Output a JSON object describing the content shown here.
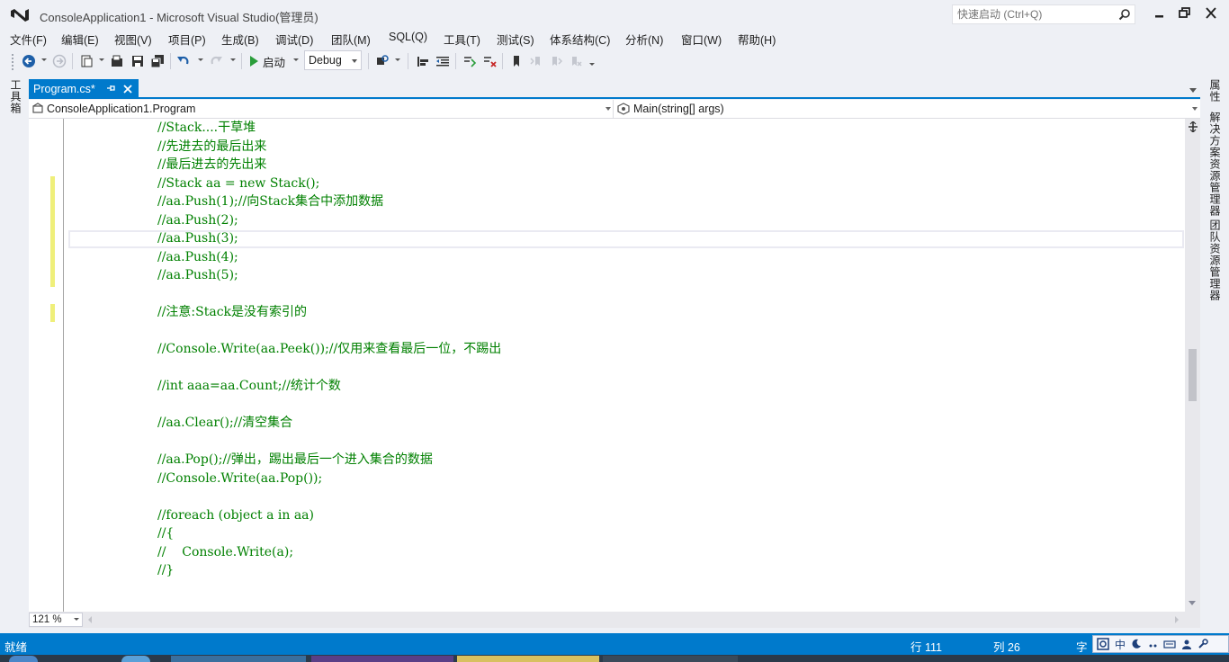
{
  "window": {
    "title": "ConsoleApplication1 - Microsoft Visual Studio(管理员)",
    "quick_launch_placeholder": "快速启动 (Ctrl+Q)"
  },
  "menu": [
    "文件(F)",
    "编辑(E)",
    "视图(V)",
    "项目(P)",
    "生成(B)",
    "调试(D)",
    "团队(M)",
    "SQL(Q)",
    "工具(T)",
    "测试(S)",
    "体系结构(C)",
    "分析(N)",
    "窗口(W)",
    "帮助(H)"
  ],
  "toolbar": {
    "start_label": "启动",
    "configuration": "Debug"
  },
  "side_tabs": {
    "left": [
      "工具箱"
    ],
    "right": [
      "属性",
      "解决方案资源管理器",
      "团队资源管理器"
    ]
  },
  "document": {
    "tab_label": "Program.cs*",
    "nav_class": "ConsoleApplication1.Program",
    "nav_member": "Main(string[] args)"
  },
  "code_lines": [
    "//Stack....干草堆",
    "//先进去的最后出来",
    "//最后进去的先出来",
    "//Stack aa = new Stack();",
    "//aa.Push(1);//向Stack集合中添加数据",
    "//aa.Push(2);",
    "//aa.Push(3);",
    "//aa.Push(4);",
    "//aa.Push(5);",
    "",
    "//注意:Stack是没有索引的",
    "",
    "//Console.Write(aa.Peek());//仅用来查看最后一位，不踢出",
    "",
    "//int aaa=aa.Count;//统计个数",
    "",
    "//aa.Clear();//清空集合",
    "",
    "//aa.Pop();//弹出，踢出最后一个进入集合的数据",
    "//Console.Write(aa.Pop());",
    "",
    "//foreach (object a in aa)",
    "//{",
    "//    Console.Write(a);",
    "//}"
  ],
  "editor": {
    "zoom": "121 %"
  },
  "status": {
    "ready": "就绪",
    "line": "行 111",
    "col": "列 26",
    "char": "字",
    "ime_mode": "中"
  },
  "colors": {
    "accent": "#007acc",
    "comment": "#008000",
    "change_marker": "#efef7a"
  }
}
